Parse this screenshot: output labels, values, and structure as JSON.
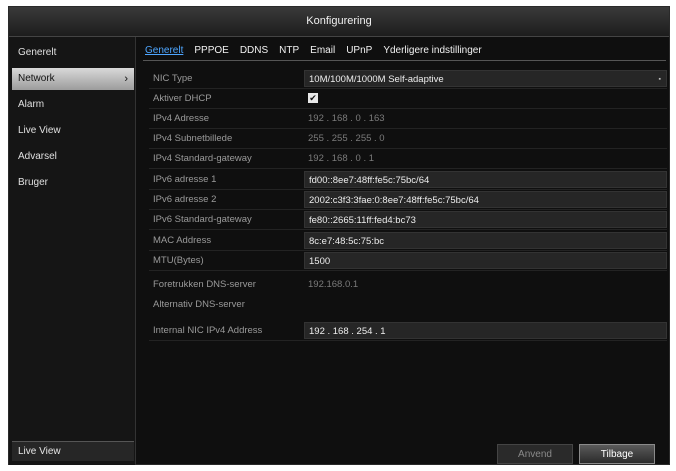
{
  "window": {
    "title": "Konfigurering"
  },
  "sidebar": {
    "items": [
      {
        "label": "Generelt"
      },
      {
        "label": "Network",
        "active": true,
        "chevron": "›"
      },
      {
        "label": "Alarm"
      },
      {
        "label": "Live View"
      },
      {
        "label": "Advarsel"
      },
      {
        "label": "Bruger"
      }
    ],
    "bottom_label": "Live View"
  },
  "tabs": [
    {
      "label": "Generelt",
      "active": true
    },
    {
      "label": "PPPOE"
    },
    {
      "label": "DDNS"
    },
    {
      "label": "NTP"
    },
    {
      "label": "Email"
    },
    {
      "label": "UPnP"
    },
    {
      "label": "Yderligere indstillinger"
    }
  ],
  "fields": {
    "nic_type": {
      "label": "NIC Type",
      "value": "10M/100M/1000M Self-adaptive",
      "arrow": "▪"
    },
    "dhcp": {
      "label": "Aktiver DHCP",
      "checked": true,
      "mark": "✔"
    },
    "ipv4_address": {
      "label": "IPv4 Adresse",
      "value": "192 . 168 . 0     . 163"
    },
    "ipv4_subnet": {
      "label": "IPv4 Subnetbillede",
      "value": "255 . 255 . 255 . 0"
    },
    "ipv4_gateway": {
      "label": "IPv4 Standard-gateway",
      "value": "192 . 168 . 0     . 1"
    },
    "ipv6_address_1": {
      "label": "IPv6 adresse 1",
      "value": "fd00::8ee7:48ff:fe5c:75bc/64"
    },
    "ipv6_address_2": {
      "label": "IPv6 adresse 2",
      "value": "2002:c3f3:3fae:0:8ee7:48ff:fe5c:75bc/64"
    },
    "ipv6_gateway": {
      "label": "IPv6 Standard-gateway",
      "value": "fe80::2665:11ff:fed4:bc73"
    },
    "mac": {
      "label": "MAC Address",
      "value": "8c:e7:48:5c:75:bc"
    },
    "mtu": {
      "label": "MTU(Bytes)",
      "value": "1500"
    },
    "dns_preferred": {
      "label": "Foretrukken DNS-server",
      "value": "192.168.0.1"
    },
    "dns_alternate": {
      "label": "Alternativ DNS-server",
      "value": ""
    },
    "internal_nic": {
      "label": "Internal NIC IPv4 Address",
      "value": "192 . 168 . 254 . 1"
    }
  },
  "buttons": {
    "apply": "Anvend",
    "back": "Tilbage"
  }
}
